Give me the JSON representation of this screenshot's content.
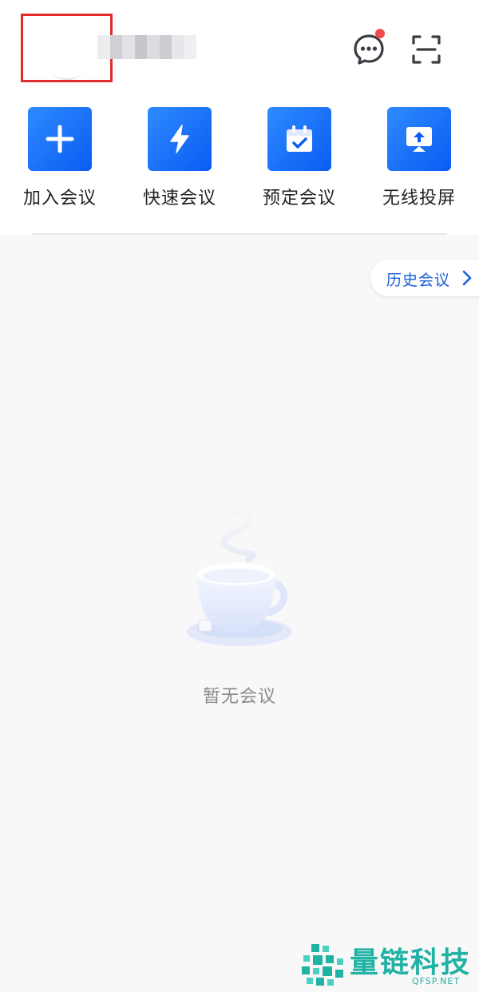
{
  "header": {
    "username": "",
    "message_badge": true
  },
  "actions": [
    {
      "label": "加入会议",
      "icon": "plus-icon"
    },
    {
      "label": "快速会议",
      "icon": "lightning-icon"
    },
    {
      "label": "预定会议",
      "icon": "calendar-check-icon"
    },
    {
      "label": "无线投屏",
      "icon": "screen-cast-icon"
    }
  ],
  "history": {
    "label": "历史会议"
  },
  "empty_state": {
    "text": "暂无会议",
    "illustration": "coffee-cup-icon"
  },
  "watermark": {
    "title": "量链科技",
    "subtitle": "QFSP.NET"
  },
  "colors": {
    "accent_blue": "#0a5cf2",
    "badge_red": "#f04a4a",
    "highlight_box": "#e22b2b",
    "watermark_teal": "#20b2a4"
  }
}
